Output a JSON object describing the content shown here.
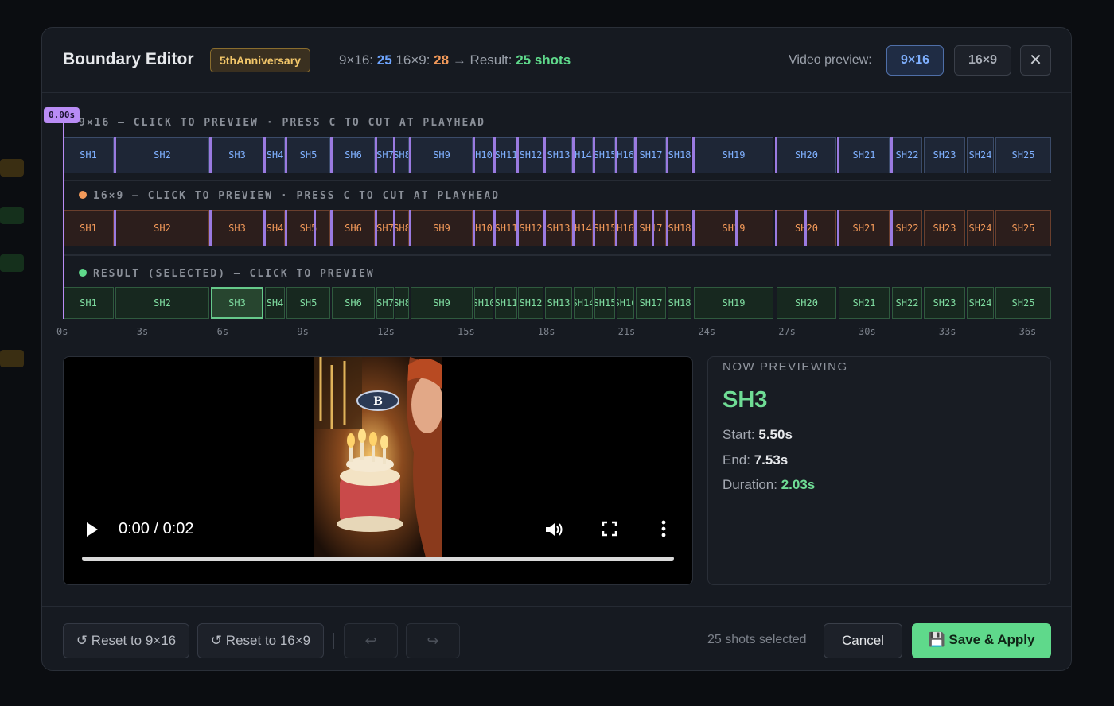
{
  "header": {
    "title": "Boundary Editor",
    "tag": "5thAnniversary",
    "stats_916_label": "9×16:",
    "stats_916_value": "25",
    "stats_169_label": "16×9:",
    "stats_169_value": "28",
    "stats_arrow": "→ Result:",
    "stats_result": "25 shots",
    "video_preview_label": "Video preview:",
    "vp_916": "9×16",
    "vp_169": "16×9",
    "close": "✕"
  },
  "playhead": {
    "label": "0.00s"
  },
  "tracks": {
    "t916": {
      "label": "9×16 — CLICK TO PREVIEW · PRESS C TO CUT AT PLAYHEAD",
      "color": "#7fb0ff"
    },
    "t169": {
      "label": "16×9 — CLICK TO PREVIEW · PRESS C TO CUT AT PLAYHEAD",
      "color": "#f39a5a"
    },
    "result": {
      "label": "RESULT (SELECTED) — CLICK TO PREVIEW",
      "color": "#5fd98b"
    }
  },
  "shots_916": [
    "SH1",
    "SH2",
    "SH3",
    "SH4",
    "SH5",
    "SH6",
    "SH7",
    "SH8",
    "SH9",
    "H10",
    "SH11",
    "SH12",
    "SH13",
    "H14",
    "SH15",
    "H16",
    "SH17",
    "SH18",
    "SH19",
    "SH20",
    "SH21",
    "SH22",
    "SH23",
    "SH24",
    "SH25"
  ],
  "shots_169": [
    "SH1",
    "SH2",
    "SH3",
    "SH4",
    "SH5",
    "SH6",
    "SH7",
    "SH8",
    "SH9",
    "H10",
    "SH11",
    "SH12",
    "SH13",
    "H14",
    "SH15",
    "H16",
    "SH17",
    "SH18",
    "SH19",
    "SH20",
    "SH21",
    "SH22",
    "SH23",
    "SH24",
    "SH25"
  ],
  "shots_result": [
    "SH1",
    "SH2",
    "SH3",
    "SH4",
    "SH5",
    "SH6",
    "SH7",
    "SH8",
    "SH9",
    "SH10",
    "SH11",
    "SH12",
    "SH13",
    "SH14",
    "SH15",
    "SH16",
    "SH17",
    "SH18",
    "SH19",
    "SH20",
    "SH21",
    "SH22",
    "SH23",
    "SH24",
    "SH25"
  ],
  "selected_index": 2,
  "ticks": [
    "0s",
    "3s",
    "6s",
    "9s",
    "12s",
    "15s",
    "18s",
    "21s",
    "24s",
    "27s",
    "30s",
    "33s",
    "36s"
  ],
  "video": {
    "time": "0:00 / 0:02"
  },
  "preview": {
    "heading": "NOW PREVIEWING",
    "shot": "SH3",
    "start_label": "Start:",
    "start_value": "5.50s",
    "end_label": "End:",
    "end_value": "7.53s",
    "duration_label": "Duration:",
    "duration_value": "2.03s"
  },
  "footer": {
    "reset_916": "↺ Reset to 9×16",
    "reset_169": "↺ Reset to 16×9",
    "undo": "↩",
    "redo": "↪",
    "shots_selected": "25 shots selected",
    "cancel": "Cancel",
    "save": "💾 Save & Apply"
  }
}
